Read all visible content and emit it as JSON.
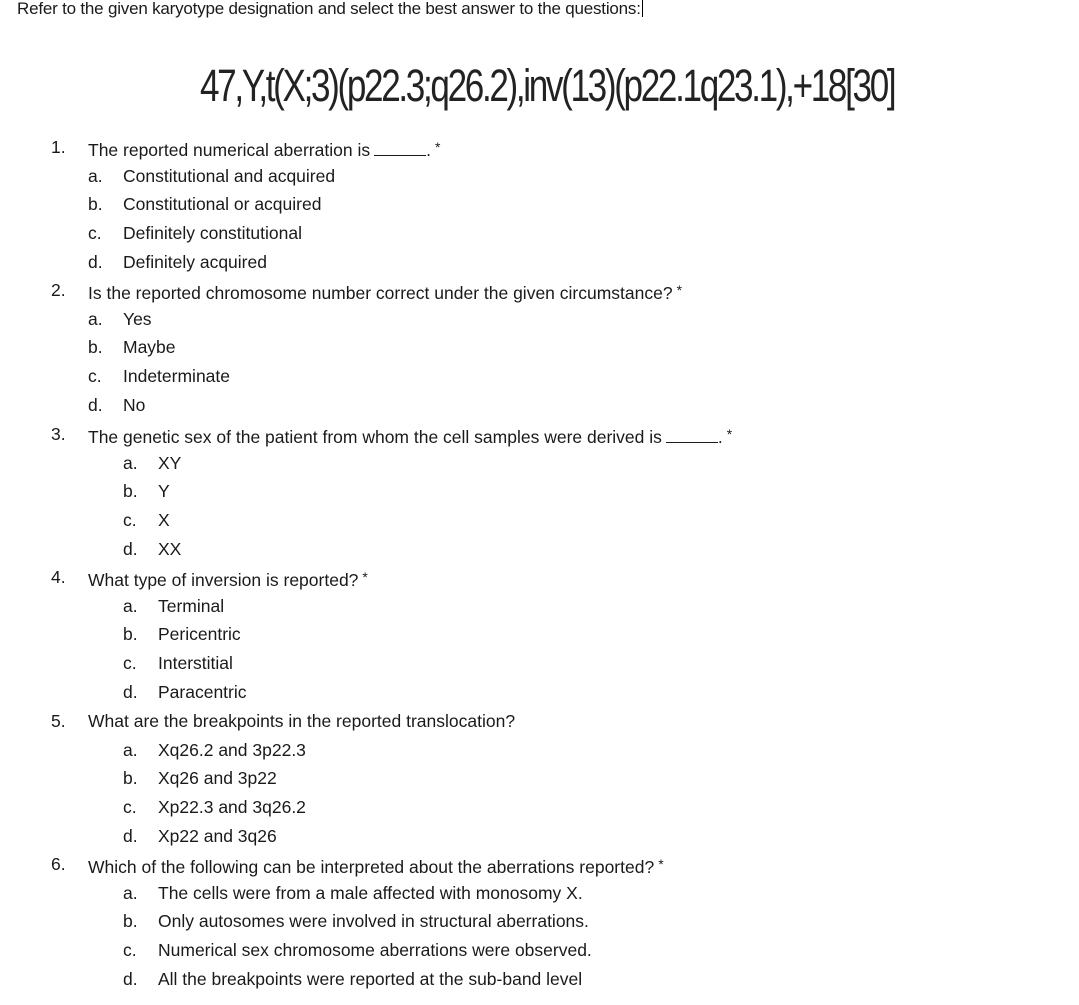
{
  "document": {
    "intro": "Refer to the given karyotype designation and select the best answer to the questions:",
    "karyotype": "47,Y,t(X;3)(p22.3;q26.2),inv(13)(p22.1q23.1),+18[30]",
    "required_marker": "*",
    "questions": [
      {
        "number": "1.",
        "text": "The reported numerical aberration is",
        "has_blank": true,
        "required": true,
        "options": [
          {
            "letter": "a.",
            "text": "Constitutional and acquired"
          },
          {
            "letter": "b.",
            "text": "Constitutional or acquired"
          },
          {
            "letter": "c.",
            "text": "Definitely constitutional"
          },
          {
            "letter": "d.",
            "text": "Definitely acquired"
          }
        ]
      },
      {
        "number": "2.",
        "text": "Is the reported chromosome number correct under the given circumstance?",
        "has_blank": false,
        "required": true,
        "options": [
          {
            "letter": "a.",
            "text": "Yes"
          },
          {
            "letter": "b.",
            "text": "Maybe"
          },
          {
            "letter": "c.",
            "text": "Indeterminate"
          },
          {
            "letter": "d.",
            "text": "No"
          }
        ]
      },
      {
        "number": "3.",
        "text": "The genetic sex of the patient from whom the cell samples were derived is",
        "has_blank": true,
        "required": true,
        "options": [
          {
            "letter": "a.",
            "text": "XY"
          },
          {
            "letter": "b.",
            "text": "Y"
          },
          {
            "letter": "c.",
            "text": "X"
          },
          {
            "letter": "d.",
            "text": "XX"
          }
        ]
      },
      {
        "number": "4.",
        "text": "What type of inversion is reported?",
        "has_blank": false,
        "required": true,
        "options": [
          {
            "letter": "a.",
            "text": "Terminal"
          },
          {
            "letter": "b.",
            "text": "Pericentric"
          },
          {
            "letter": "c.",
            "text": "Interstitial"
          },
          {
            "letter": "d.",
            "text": "Paracentric"
          }
        ]
      },
      {
        "number": "5.",
        "text": "What are the breakpoints in the reported translocation?",
        "has_blank": false,
        "required": false,
        "options": [
          {
            "letter": "a.",
            "text": "Xq26.2 and 3p22.3"
          },
          {
            "letter": "b.",
            "text": "Xq26 and 3p22"
          },
          {
            "letter": "c.",
            "text": "Xp22.3 and 3q26.2"
          },
          {
            "letter": "d.",
            "text": "Xp22 and 3q26"
          }
        ]
      },
      {
        "number": "6.",
        "text": "Which of the following can be interpreted about the aberrations reported?",
        "has_blank": false,
        "required": true,
        "options": [
          {
            "letter": "a.",
            "text": "The cells were from a male affected with monosomy X."
          },
          {
            "letter": "b.",
            "text": "Only autosomes were involved in structural aberrations."
          },
          {
            "letter": "c.",
            "text": "Numerical sex chromosome aberrations were observed."
          },
          {
            "letter": "d.",
            "text": "All the breakpoints were reported at the sub-band level"
          }
        ]
      }
    ]
  }
}
